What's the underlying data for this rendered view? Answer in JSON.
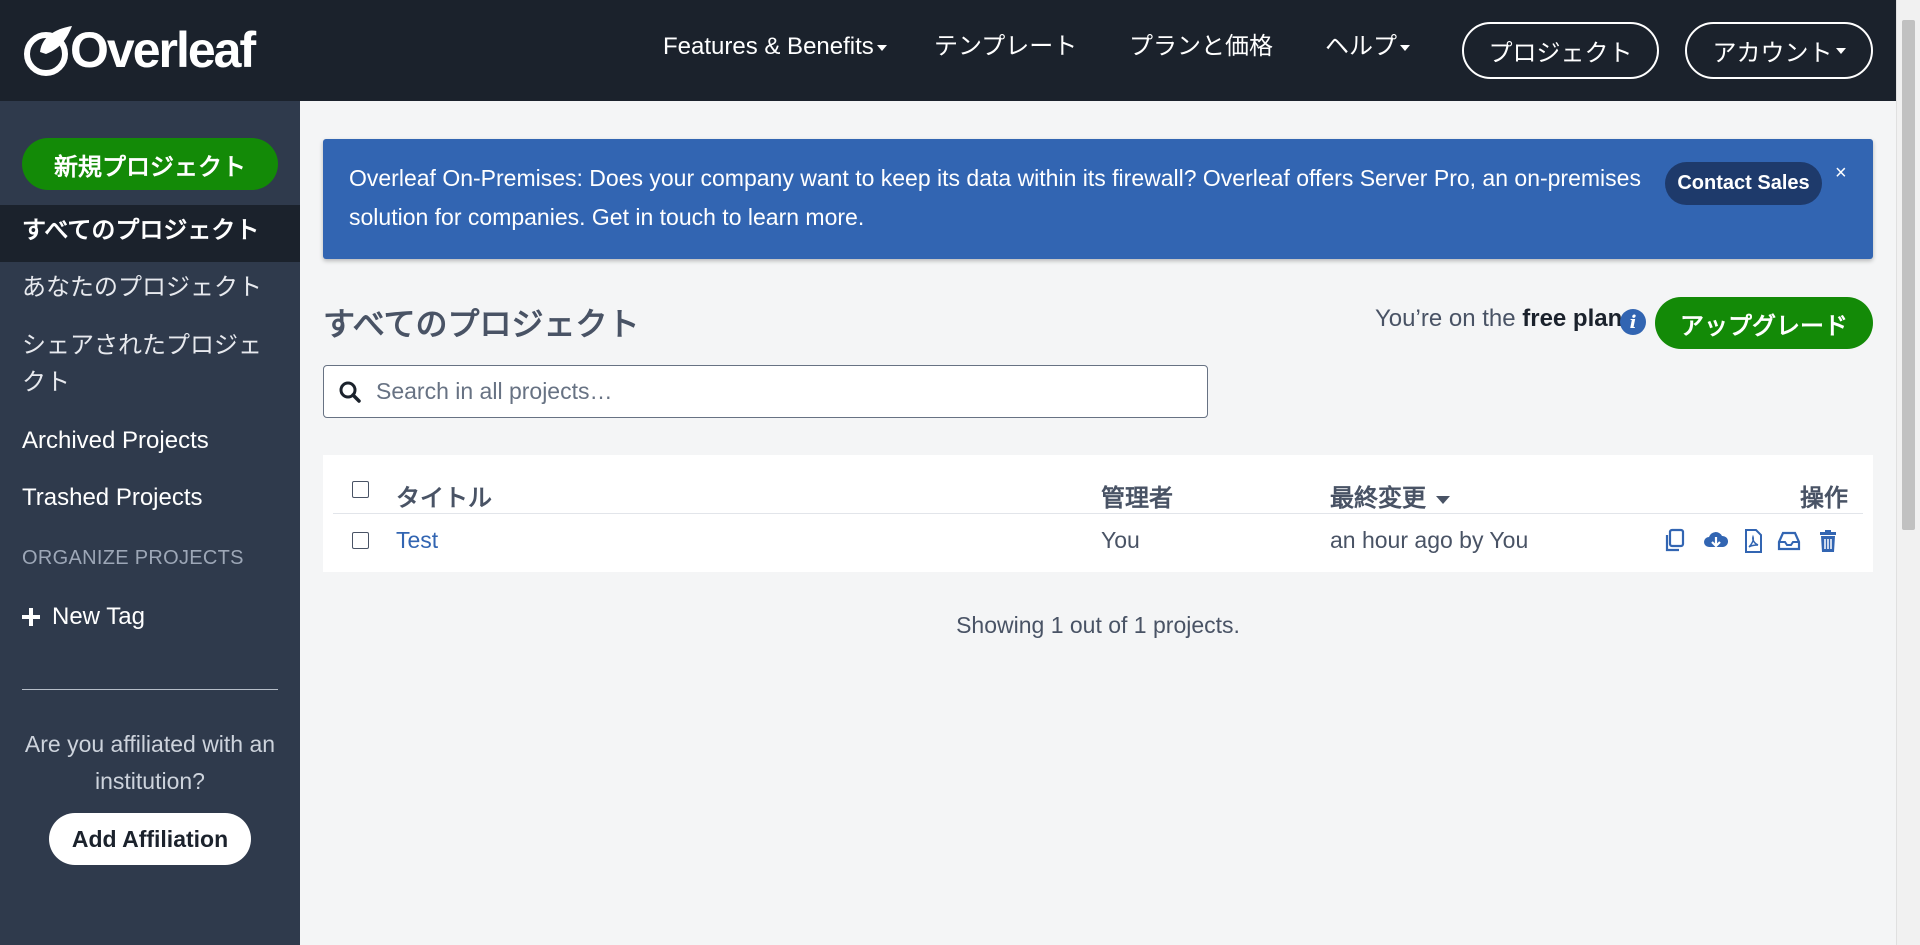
{
  "nav": {
    "logo": "Overleaf",
    "items": [
      {
        "label": "Features & Benefits",
        "dropdown": true
      },
      {
        "label": "テンプレート",
        "dropdown": false
      },
      {
        "label": "プランと価格",
        "dropdown": false
      },
      {
        "label": "ヘルプ",
        "dropdown": true
      }
    ],
    "projects_button": "プロジェクト",
    "account_button": "アカウント"
  },
  "sidebar": {
    "new_project": "新規プロジェクト",
    "items": [
      {
        "label": "すべてのプロジェクト",
        "active": true
      },
      {
        "label": "あなたのプロジェクト",
        "active": false
      },
      {
        "label": "シェアされたプロジェクト",
        "active": false
      },
      {
        "label": "Archived Projects",
        "active": false
      },
      {
        "label": "Trashed Projects",
        "active": false
      }
    ],
    "organize_heading": "ORGANIZE PROJECTS",
    "new_tag": "New Tag",
    "affiliation_prompt": "Are you affiliated with an institution?",
    "add_affiliation": "Add Affiliation"
  },
  "banner": {
    "text": "Overleaf On-Premises: Does your company want to keep its data within its firewall? Overleaf offers Server Pro, an on-premises solution for companies. Get in touch to learn more.",
    "contact_button": "Contact Sales",
    "close": "×"
  },
  "main": {
    "title": "すべてのプロジェクト",
    "plan_prefix": "You’re on the ",
    "plan_name": "free plan",
    "upgrade_button": "アップグレード",
    "search_placeholder": "Search in all projects…"
  },
  "table": {
    "headers": {
      "title": "タイトル",
      "owner": "管理者",
      "last_modified": "最終変更",
      "actions": "操作"
    },
    "rows": [
      {
        "title": "Test",
        "owner": "You",
        "last_modified": "an hour ago by You"
      }
    ],
    "actions": [
      "copy-icon",
      "download-icon",
      "pdf-icon",
      "archive-icon",
      "trash-icon"
    ],
    "footer": "Showing 1 out of 1 projects."
  },
  "colors": {
    "nav_bg": "#1b222c",
    "sidebar_bg": "#2f3a4c",
    "accent_green": "#138a07",
    "banner_blue": "#3265b2",
    "link_blue": "#3265b2"
  }
}
